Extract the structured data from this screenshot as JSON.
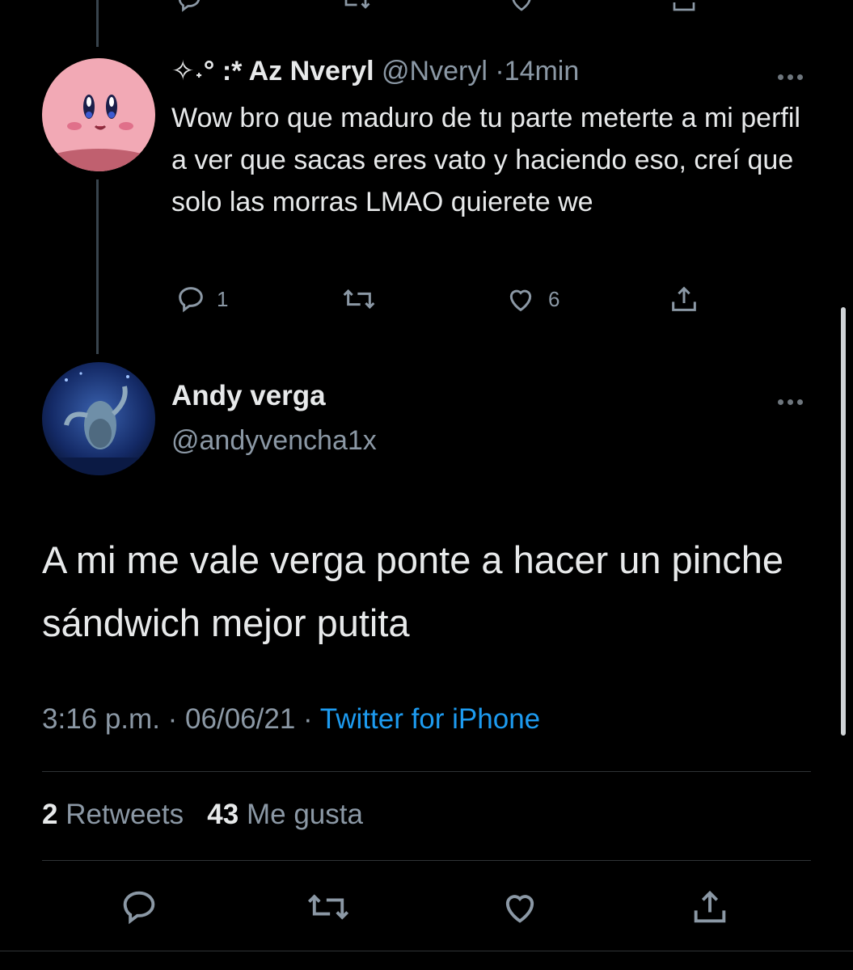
{
  "reply": {
    "author_name": "✧˖° :* Az Nveryl",
    "handle": "@Nveryl",
    "separator": "·",
    "time": "14min",
    "text": "Wow bro que maduro de tu parte meterte a mi perfil a ver que sacas eres vato y haciendo eso, creí que solo las morras LMAO quierete we",
    "reply_count": "1",
    "like_count": "6"
  },
  "main_tweet": {
    "author_name": "Andy verga",
    "handle": "@andyvencha1x",
    "text": "A mi me vale verga ponte a hacer un pinche sándwich mejor putita",
    "time": "3:16 p.m.",
    "date": "06/06/21",
    "separator": "·",
    "source": "Twitter for iPhone",
    "retweets_count": "2",
    "retweets_label": "Retweets",
    "likes_count": "43",
    "likes_label": "Me gusta"
  },
  "icons": {
    "reply": "reply-icon",
    "retweet": "retweet-icon",
    "like": "heart-icon",
    "share": "share-icon",
    "more": "more-icon"
  },
  "colors": {
    "background": "#000000",
    "primary_text": "#e7e9ea",
    "secondary_text": "#8b98a5",
    "link": "#1d9bf0",
    "thread_line": "#38444d"
  }
}
